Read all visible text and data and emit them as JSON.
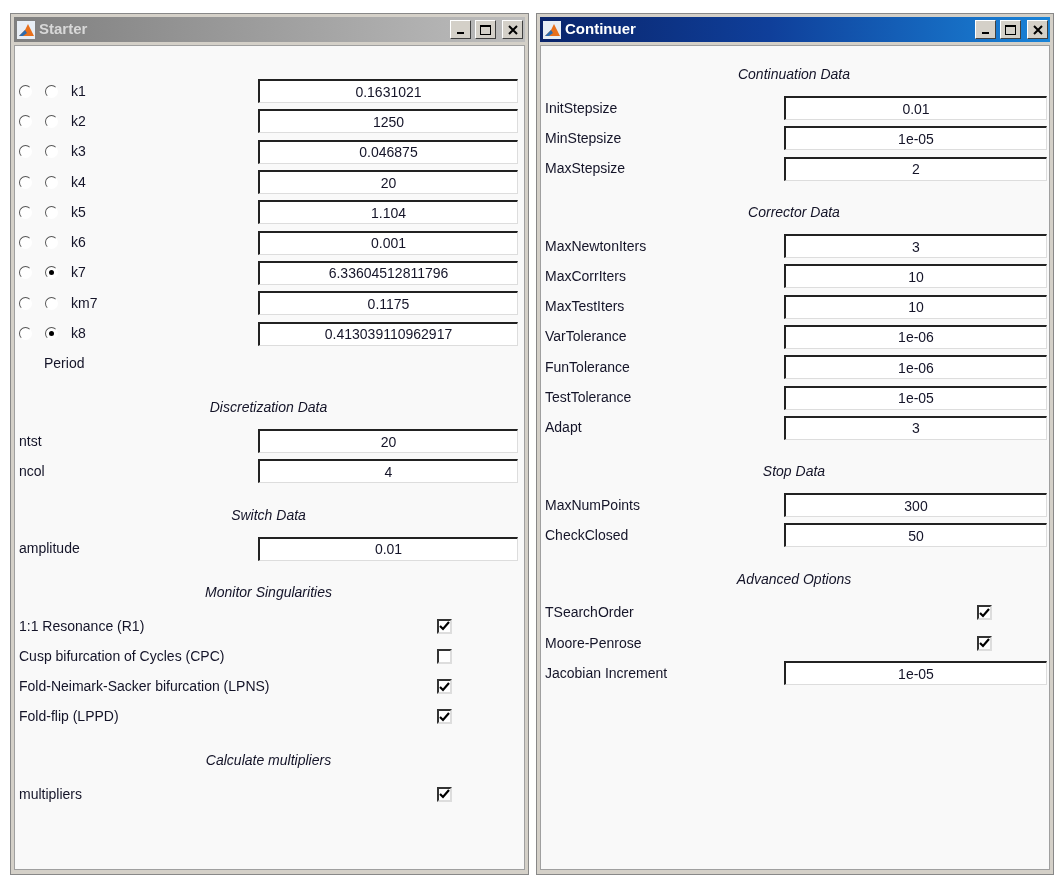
{
  "windows": [
    {
      "title": "Starter",
      "active": false,
      "sections": [
        {
          "rows": [
            {
              "kind": "param",
              "radio_1_selected": false,
              "radio_2_selected": false,
              "label": "k1",
              "value": "0.1631021"
            },
            {
              "kind": "param",
              "radio_1_selected": false,
              "radio_2_selected": false,
              "label": "k2",
              "value": "1250"
            },
            {
              "kind": "param",
              "radio_1_selected": false,
              "radio_2_selected": false,
              "label": "k3",
              "value": "0.046875"
            },
            {
              "kind": "param",
              "radio_1_selected": false,
              "radio_2_selected": false,
              "label": "k4",
              "value": "20"
            },
            {
              "kind": "param",
              "radio_1_selected": false,
              "radio_2_selected": false,
              "label": "k5",
              "value": "1.104"
            },
            {
              "kind": "param",
              "radio_1_selected": false,
              "radio_2_selected": false,
              "label": "k6",
              "value": "0.001"
            },
            {
              "kind": "param",
              "radio_1_selected": false,
              "radio_2_selected": true,
              "label": "k7",
              "value": "6.33604512811796"
            },
            {
              "kind": "param",
              "radio_1_selected": false,
              "radio_2_selected": false,
              "label": "km7",
              "value": "0.1175"
            },
            {
              "kind": "param",
              "radio_1_selected": false,
              "radio_2_selected": true,
              "label": "k8",
              "value": "0.413039110962917"
            },
            {
              "kind": "note",
              "label": "Period"
            }
          ]
        },
        {
          "heading": "Discretization Data",
          "rows": [
            {
              "kind": "field",
              "label": "ntst",
              "value": "20"
            },
            {
              "kind": "field",
              "label": "ncol",
              "value": "4"
            }
          ]
        },
        {
          "heading": "Switch Data",
          "rows": [
            {
              "kind": "field",
              "label": "amplitude",
              "value": "0.01"
            }
          ]
        },
        {
          "heading": "Monitor Singularities",
          "rows": [
            {
              "kind": "check",
              "label": "1:1 Resonance (R1)",
              "checked": true
            },
            {
              "kind": "check",
              "label": "Cusp bifurcation of Cycles (CPC)",
              "checked": false
            },
            {
              "kind": "check",
              "label": "Fold-Neimark-Sacker bifurcation (LPNS)",
              "checked": true
            },
            {
              "kind": "check",
              "label": "Fold-flip (LPPD)",
              "checked": true
            }
          ]
        },
        {
          "heading": "Calculate multipliers",
          "rows": [
            {
              "kind": "check",
              "label": "multipliers",
              "checked": true
            }
          ]
        }
      ]
    },
    {
      "title": "Continuer",
      "active": true,
      "sections": [
        {
          "heading": "Continuation Data",
          "rows": [
            {
              "kind": "field",
              "label": "InitStepsize",
              "value": "0.01"
            },
            {
              "kind": "field",
              "label": "MinStepsize",
              "value": "1e-05"
            },
            {
              "kind": "field",
              "label": "MaxStepsize",
              "value": "2"
            }
          ]
        },
        {
          "heading": "Corrector Data",
          "rows": [
            {
              "kind": "field",
              "label": "MaxNewtonIters",
              "value": "3"
            },
            {
              "kind": "field",
              "label": "MaxCorrIters",
              "value": "10"
            },
            {
              "kind": "field",
              "label": "MaxTestIters",
              "value": "10"
            },
            {
              "kind": "field",
              "label": "VarTolerance",
              "value": "1e-06"
            },
            {
              "kind": "field",
              "label": "FunTolerance",
              "value": "1e-06"
            },
            {
              "kind": "field",
              "label": "TestTolerance",
              "value": "1e-05"
            },
            {
              "kind": "field",
              "label": "Adapt",
              "value": "3"
            }
          ]
        },
        {
          "heading": "Stop Data",
          "rows": [
            {
              "kind": "field",
              "label": "MaxNumPoints",
              "value": "300"
            },
            {
              "kind": "field",
              "label": "CheckClosed",
              "value": "50"
            }
          ]
        },
        {
          "heading": "Advanced Options",
          "rows": [
            {
              "kind": "check",
              "label": "TSearchOrder",
              "checked": true
            },
            {
              "kind": "check",
              "label": "Moore-Penrose",
              "checked": true
            },
            {
              "kind": "field",
              "label": "Jacobian Increment",
              "value": "1e-05"
            }
          ]
        }
      ]
    }
  ]
}
